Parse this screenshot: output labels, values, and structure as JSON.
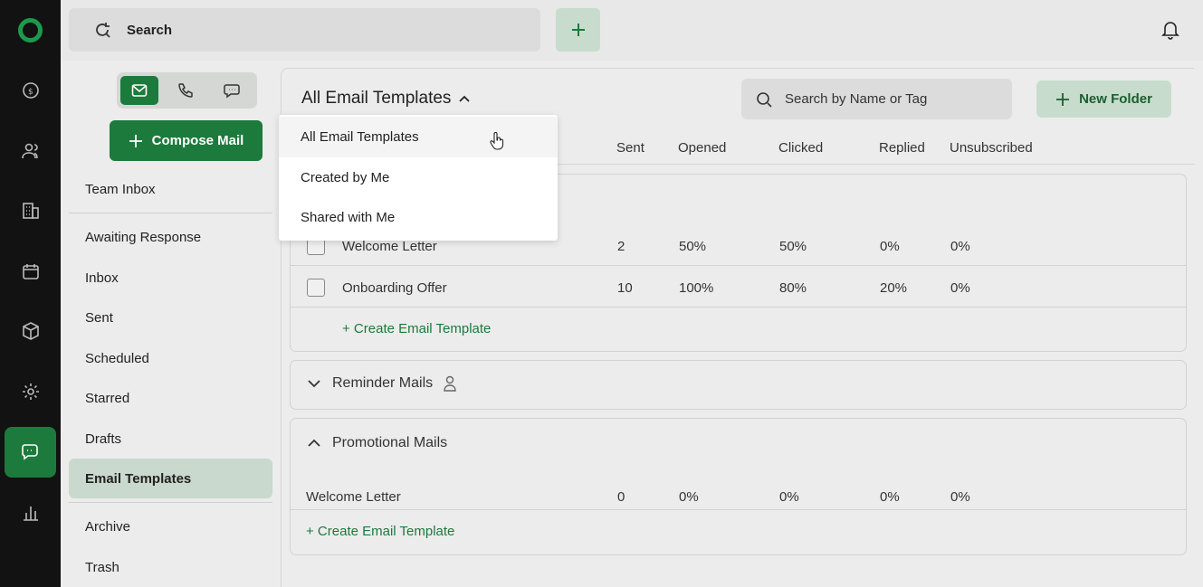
{
  "topbar": {
    "search_label": "Search"
  },
  "left_panel": {
    "compose_label": "Compose Mail",
    "nav": [
      {
        "label": "Team Inbox"
      },
      {
        "label": "Awaiting Response"
      },
      {
        "label": "Inbox"
      },
      {
        "label": "Sent"
      },
      {
        "label": "Scheduled"
      },
      {
        "label": "Starred"
      },
      {
        "label": "Drafts"
      },
      {
        "label": "Email Templates",
        "active": true
      },
      {
        "label": "Archive"
      },
      {
        "label": "Trash"
      }
    ]
  },
  "main": {
    "title": "All Email Templates",
    "search_placeholder": "Search by Name or Tag",
    "new_folder_label": "New Folder",
    "columns": [
      "Sent",
      "Opened",
      "Clicked",
      "Replied",
      "Unsubscribed"
    ],
    "folder1": {
      "rows": [
        {
          "name": "Welcome Letter",
          "sent": "2",
          "opened": "50%",
          "clicked": "50%",
          "replied": "0%",
          "unsubscribed": "0%"
        },
        {
          "name": "Onboarding Offer",
          "sent": "10",
          "opened": "100%",
          "clicked": "80%",
          "replied": "20%",
          "unsubscribed": "0%"
        }
      ],
      "create_label": "+ Create Email Template"
    },
    "folder2": {
      "name": "Reminder Mails"
    },
    "folder3": {
      "name": "Promotional Mails",
      "rows": [
        {
          "name": "Welcome Letter",
          "sent": "0",
          "opened": "0%",
          "clicked": "0%",
          "replied": "0%",
          "unsubscribed": "0%"
        }
      ],
      "create_label": "+ Create Email Template"
    }
  },
  "dropdown": {
    "items": [
      "All Email Templates",
      "Created by Me",
      "Shared with Me"
    ]
  },
  "colors": {
    "brand": "#1c7a3c",
    "brand_soft": "#c7dccd"
  }
}
